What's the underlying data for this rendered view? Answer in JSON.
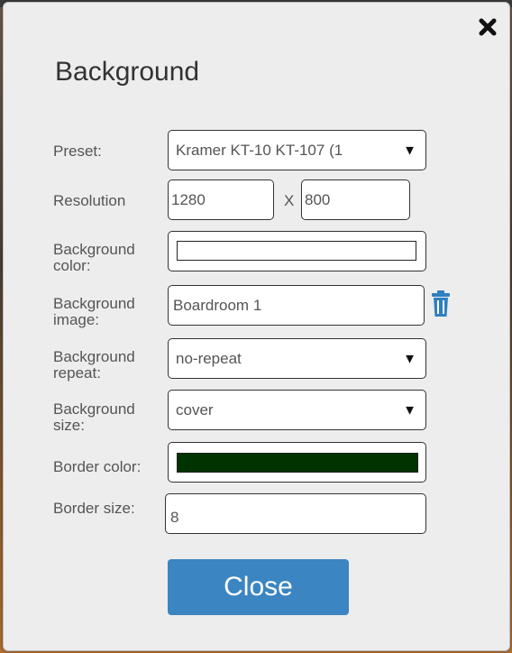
{
  "dialog": {
    "title": "Background",
    "close_icon": "close-icon",
    "close_button_label": "Close"
  },
  "fields": {
    "preset": {
      "label": "Preset:",
      "value": "Kramer KT-10 KT-107 (1"
    },
    "resolution": {
      "label": "Resolution",
      "width": "1280",
      "separator": "X",
      "height": "800"
    },
    "background_color": {
      "label_line1": "Background",
      "label_line2": "color:",
      "value_color": "#ffffff"
    },
    "background_image": {
      "label_line1": "Background",
      "label_line2": "image:",
      "value": "Boardroom 1",
      "delete_icon": "trash-icon"
    },
    "background_repeat": {
      "label_line1": "Background",
      "label_line2": "repeat:",
      "value": "no-repeat"
    },
    "background_size": {
      "label_line1": "Background",
      "label_line2": "size:",
      "value": "cover"
    },
    "border_color": {
      "label": "Border color:",
      "value_color": "#003300"
    },
    "border_size": {
      "label": "Border size:",
      "value": "8"
    }
  },
  "colors": {
    "button": "#3b86c2",
    "icon_blue": "#2f7fc1"
  }
}
